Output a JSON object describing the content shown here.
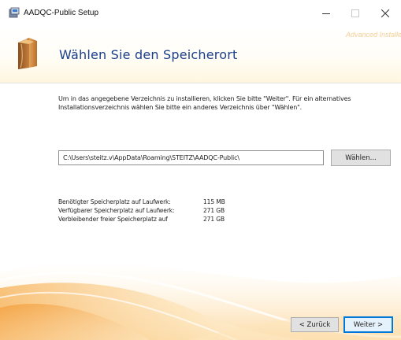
{
  "window": {
    "title": "AADQC-Public Setup",
    "icon": "setup-app-icon",
    "controls": {
      "minimize": "minimize-icon",
      "maximize": "maximize-icon",
      "close": "close-icon"
    }
  },
  "header": {
    "title": "Wählen Sie den Speicherort",
    "brand": "Advanced Installer"
  },
  "main": {
    "description_line1": "Um in das angegebene Verzeichnis zu installieren, klicken Sie bitte \"Weiter\". Für ein alternatives",
    "description_line2": "Installationsverzeichnis wählen Sie bitte ein anderes Verzeichnis über \"Wählen\".",
    "path_value": "C:\\Users\\steitz.v\\AppData\\Roaming\\STEITZ\\AADQC-Public\\",
    "browse_label": "Wählen...",
    "space": [
      {
        "label": "Benötigter Speicherplatz auf Laufwerk:",
        "value": "115 MB"
      },
      {
        "label": "Verfügbarer Speicherplatz auf Laufwerk:",
        "value": "271 GB"
      },
      {
        "label": "Verbleibender freier Speicherplatz auf",
        "value": "271 GB"
      }
    ]
  },
  "footer": {
    "back_label": "< Zurück",
    "next_label": "Weiter >"
  },
  "colors": {
    "title_blue": "#1a3f8a",
    "accent_blue": "#0078d7",
    "wave_orange": "#f6b45a"
  }
}
